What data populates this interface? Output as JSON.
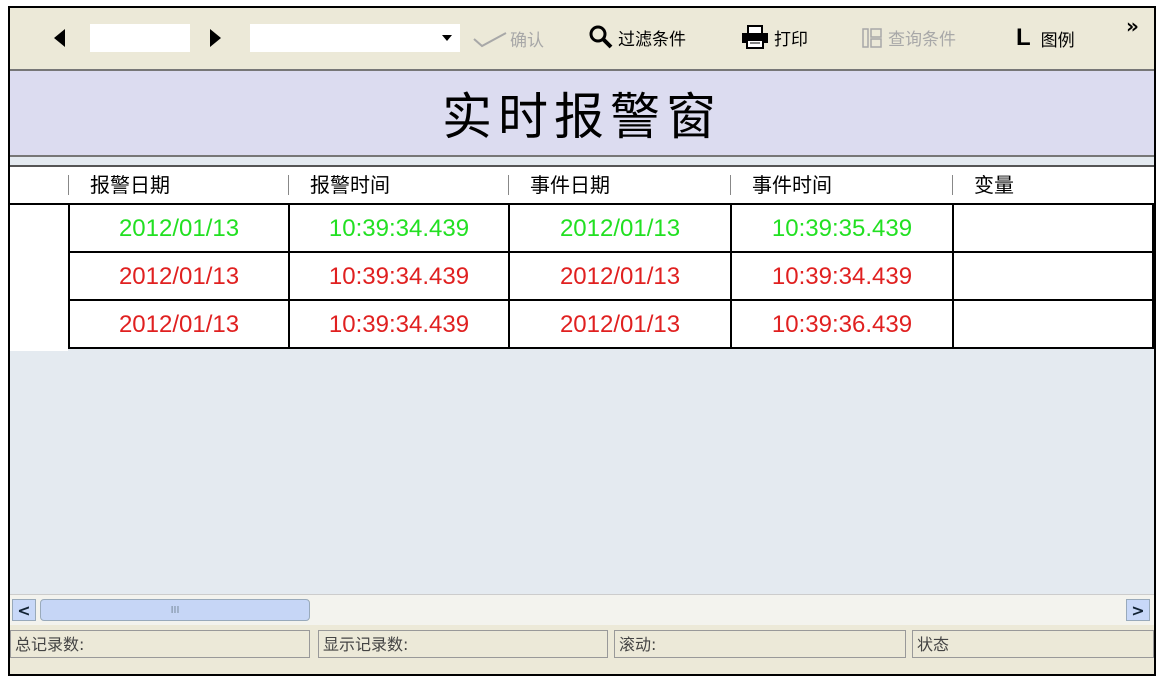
{
  "toolbar": {
    "prev_icon": "triangle-left-icon",
    "next_icon": "triangle-right-icon",
    "date_value": "",
    "combo_value": "",
    "confirm_label": "确认",
    "filter_label": "过滤条件",
    "print_label": "打印",
    "query_label": "查询条件",
    "legend_label": "图例",
    "more_label": "»"
  },
  "title": "实时报警窗",
  "columns": [
    "报警日期",
    "报警时间",
    "事件日期",
    "事件时间",
    "变量"
  ],
  "rows": [
    {
      "cells": [
        "2012/01/13",
        "10:39:34.439",
        "2012/01/13",
        "10:39:35.439",
        ""
      ],
      "color": "#22e022"
    },
    {
      "cells": [
        "2012/01/13",
        "10:39:34.439",
        "2012/01/13",
        "10:39:34.439",
        ""
      ],
      "color": "#e02020"
    },
    {
      "cells": [
        "2012/01/13",
        "10:39:34.439",
        "2012/01/13",
        "10:39:36.439",
        ""
      ],
      "color": "#e02020"
    }
  ],
  "scrollbar": {
    "left_icon": "chevron-left-icon",
    "right_icon": "chevron-right-icon",
    "grip": "III"
  },
  "status": {
    "total": "总记录数:",
    "shown": "显示记录数:",
    "scroll": "滚动:",
    "state": "状态"
  }
}
